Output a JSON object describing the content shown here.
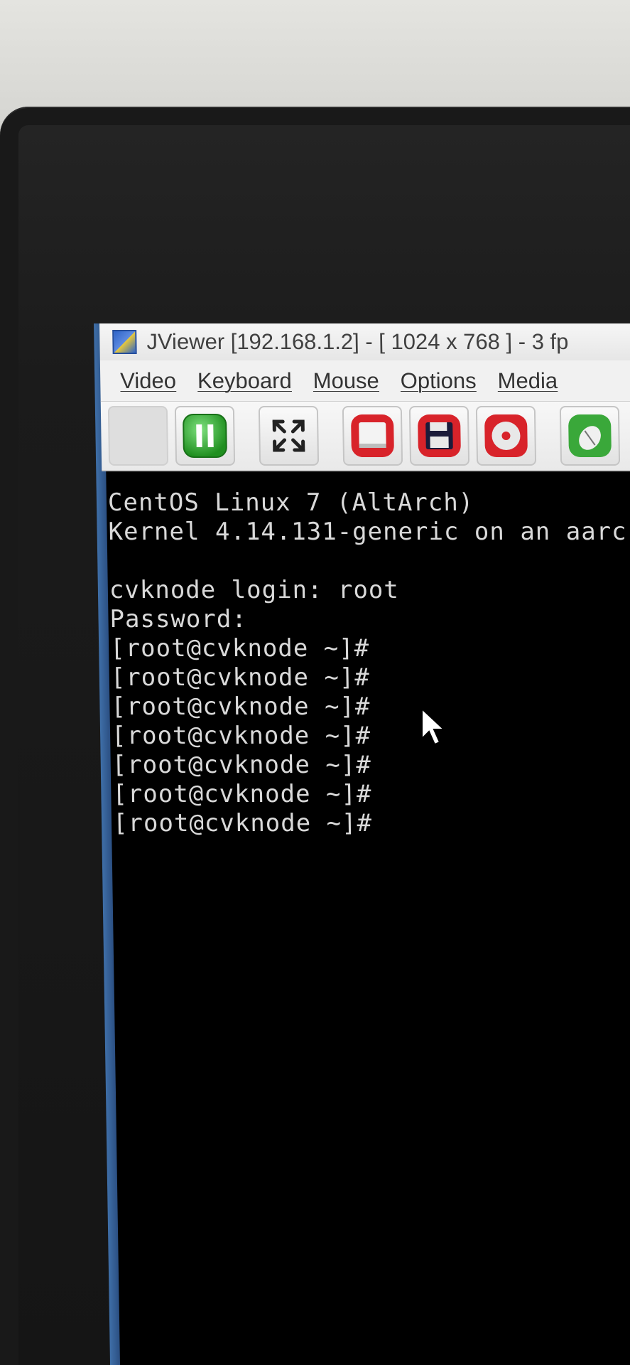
{
  "window": {
    "title": "JViewer [192.168.1.2] - [ 1024 x 768 ] - 3 fp"
  },
  "menu": [
    {
      "label": "Video"
    },
    {
      "label": "Keyboard"
    },
    {
      "label": "Mouse"
    },
    {
      "label": "Options"
    },
    {
      "label": "Media"
    }
  ],
  "toolbar": {
    "buttons": [
      {
        "icon": "blank-icon",
        "state": "disabled"
      },
      {
        "icon": "pause-icon",
        "color": "#2fa82f"
      },
      {
        "icon": "fullscreen-icon"
      },
      {
        "icon": "floppy-drive-icon",
        "color": "#d8232a"
      },
      {
        "icon": "save-disk-icon",
        "color": "#d8232a"
      },
      {
        "icon": "cd-rom-icon",
        "color": "#d8232a"
      },
      {
        "icon": "mouse-icon",
        "color": "#3aa83a"
      }
    ]
  },
  "terminal": {
    "lines": [
      "CentOS Linux 7 (AltArch)",
      "Kernel 4.14.131-generic on an aarc",
      "",
      "cvknode login: root",
      "Password:",
      "[root@cvknode ~]#",
      "[root@cvknode ~]#",
      "[root@cvknode ~]#",
      "[root@cvknode ~]#",
      "[root@cvknode ~]#",
      "[root@cvknode ~]#",
      "[root@cvknode ~]#"
    ]
  }
}
